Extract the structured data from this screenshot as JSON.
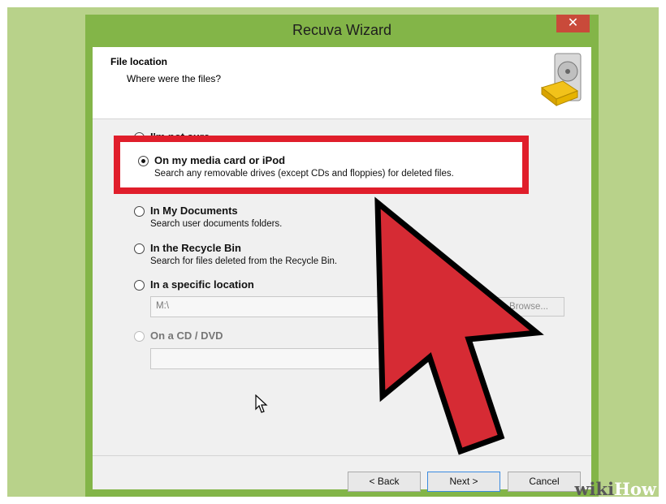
{
  "window": {
    "title": "Recuva Wizard",
    "close_label": "✕"
  },
  "header": {
    "title": "File location",
    "subtitle": "Where were the files?",
    "icon": "disk-drive-icon"
  },
  "options": [
    {
      "label": "I'm not sure",
      "description": "",
      "selected": false,
      "disabled": false
    },
    {
      "label": "On my media card or iPod",
      "description": "Search any removable drives (except CDs and floppies) for deleted files.",
      "selected": true,
      "disabled": false
    },
    {
      "label": "In My Documents",
      "description": "Search user documents folders.",
      "selected": false,
      "disabled": false
    },
    {
      "label": "In the Recycle Bin",
      "description": "Search for files deleted from the Recycle Bin.",
      "selected": false,
      "disabled": false
    },
    {
      "label": "In a specific location",
      "description": "",
      "selected": false,
      "disabled": false
    },
    {
      "label": "On a CD / DVD",
      "description": "",
      "selected": false,
      "disabled": true
    }
  ],
  "location": {
    "path_value": "M:\\",
    "browse_label": "Browse..."
  },
  "buttons": {
    "back": "< Back",
    "next": "Next >",
    "cancel": "Cancel"
  },
  "watermark": {
    "wiki": "wiki",
    "how": "How"
  },
  "colors": {
    "highlight": "#e01e2b",
    "background": "#b8d28a",
    "titlebar": "#83b548",
    "close": "#c94a3a"
  }
}
